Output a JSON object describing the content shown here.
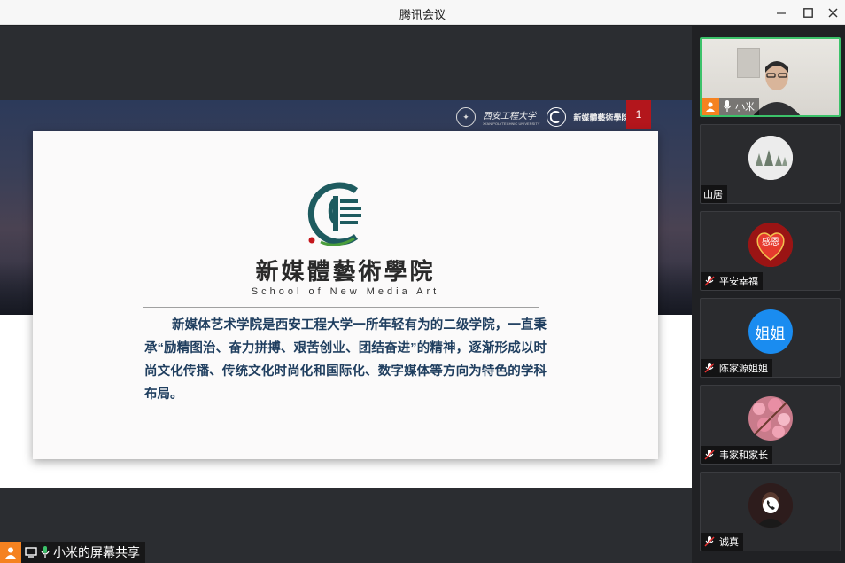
{
  "window": {
    "title": "腾讯会议"
  },
  "slide": {
    "page_number": "1",
    "university_logo_text": "西安工程大学",
    "university_sub": "XI'AN POLYTECHNIC UNIVERSITY",
    "school_logo_text": "新媒體藝術學院",
    "school_name_cn": "新媒體藝術學院",
    "school_name_en": "School of New Media Art",
    "intro": "新媒体艺术学院是西安工程大学一所年轻有为的二级学院，一直秉承“励精图治、奋力拼搏、艰苦创业、团结奋进”的精神，逐渐形成以时尚文化传播、传统文化时尚化和国际化、数字媒体等方向为特色的学科布局。"
  },
  "share": {
    "label": "小米的屏幕共享"
  },
  "participants": [
    {
      "name": "小米",
      "type": "video",
      "active": true
    },
    {
      "name": "山居",
      "type": "avatar",
      "avatar_style": "trees"
    },
    {
      "name": "平安幸福",
      "type": "avatar",
      "avatar_style": "heart",
      "avatar_text": "感恩"
    },
    {
      "name": "陈家源姐姐",
      "type": "avatar",
      "avatar_style": "text",
      "avatar_text": "姐姐"
    },
    {
      "name": "韦家和家长",
      "type": "avatar",
      "avatar_style": "flowers"
    },
    {
      "name": "诚真",
      "type": "avatar",
      "avatar_style": "phone"
    }
  ],
  "colors": {
    "accent_green": "#3cc26a",
    "orange": "#f58220",
    "slide_red": "#b3161c",
    "intro_text": "#1f3e5f"
  }
}
